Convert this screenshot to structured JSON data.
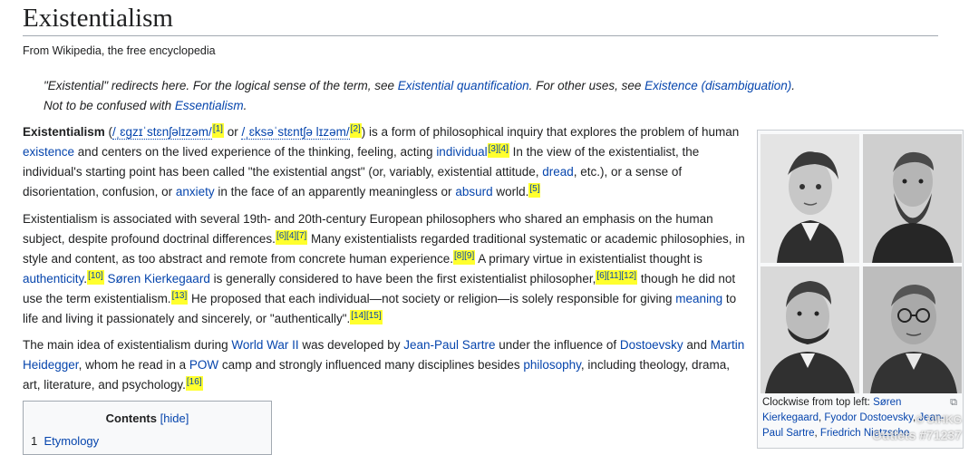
{
  "page": {
    "title": "Existentialism",
    "tagline": "From Wikipedia, the free encyclopedia"
  },
  "hatnotes": {
    "redirect_pre": "\"Existential\" redirects here. For the logical sense of the term, see ",
    "redirect_link1": "Existential quantification",
    "redirect_mid": ". For other uses, see ",
    "redirect_link2": "Existence (disambiguation)",
    "redirect_end": ".",
    "confused_pre": "Not to be confused with ",
    "confused_link": "Essentialism",
    "confused_end": "."
  },
  "p1": {
    "bold": "Existentialism",
    "t1": " (",
    "ipa1": "/ˌɛɡzɪˈstɛnʃəlɪzəm/",
    "r1": "[1]",
    "t2": " or ",
    "ipa2": "/ˌɛksəˈstɛntʃə lɪzəm/",
    "r2": "[2]",
    "t3": ") is a form of philosophical inquiry that explores the problem of human ",
    "l_existence": "existence",
    "t4": " and centers on the lived experience of the thinking, feeling, acting ",
    "l_individual": "individual",
    "r3": "[3][4]",
    "t5": " In the view of the existentialist, the individual's starting point has been called \"the existential angst\" (or, variably, existential attitude, ",
    "l_dread": "dread",
    "t6": ", etc.), or a sense of disorientation, confusion, or ",
    "l_anxiety": "anxiety",
    "t7": " in the face of an apparently meaningless or ",
    "l_absurd": "absurd",
    "t8": " world.",
    "r4": "[5]"
  },
  "p2": {
    "t1": "Existentialism is associated with several 19th- and 20th-century European philosophers who shared an emphasis on the human subject, despite profound doctrinal differences.",
    "r1": "[6][4][7]",
    "t2": " Many existentialists regarded traditional systematic or academic philosophies, in style and content, as too abstract and remote from concrete human experience.",
    "r2": "[8][9]",
    "t3": " A primary virtue in existentialist thought is ",
    "l_authenticity": "authenticity",
    "t4": ".",
    "r3": "[10]",
    "t5": " ",
    "l_kierkegaard": "Søren Kierkegaard",
    "t6": " is generally considered to have been the first existentialist philosopher,",
    "r4": "[6][11][12]",
    "t7": " though he did not use the term existentialism.",
    "r5": "[13]",
    "t8": " He proposed that each individual—not society or religion—is solely responsible for giving ",
    "l_meaning": "meaning",
    "t9": " to life and living it passionately and sincerely, or \"authentically\".",
    "r6": "[14][15]"
  },
  "p3": {
    "t1": "The main idea of existentialism during ",
    "l_ww2": "World War II",
    "t2": " was developed by ",
    "l_sartre": "Jean-Paul Sartre",
    "t3": " under the influence of ",
    "l_dostoevsky": "Dostoevsky",
    "t4": " and ",
    "l_heidegger": "Martin Heidegger",
    "t5": ", whom he read in a ",
    "l_pow": "POW",
    "t6": " camp and strongly influenced many disciplines besides ",
    "l_philosophy": "philosophy",
    "t7": ", including theology, drama, art, literature, and psychology.",
    "r1": "[16]"
  },
  "infobox": {
    "caption_pre": "Clockwise from top left: ",
    "c_kierkegaard": "Søren Kierkegaard",
    "c_sep1": ", ",
    "c_dostoevsky": "Fyodor Dostoevsky",
    "c_sep2": ", ",
    "c_sartre": "Jean-Paul Sartre",
    "c_sep3": ", ",
    "c_nietzsche": "Friedrich Nietzsche",
    "enlarge_icon": "enlarge-icon"
  },
  "watermark": {
    "line1": "© UIHKG",
    "line2": "Outlets #71237"
  },
  "toc": {
    "title": "Contents",
    "hide_label": "[hide]",
    "items": [
      {
        "number": "1",
        "label": "Etymology"
      }
    ]
  }
}
